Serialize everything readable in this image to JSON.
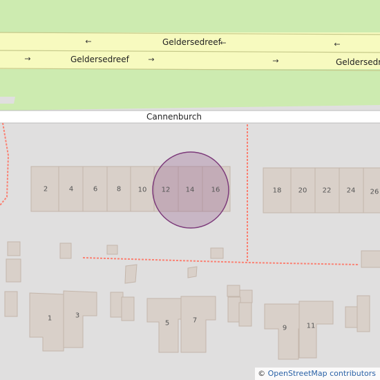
{
  "roads": {
    "main_road": "Geldersedreef",
    "side_road": "Cannenburch"
  },
  "house_numbers_top": [
    "2",
    "4",
    "6",
    "8",
    "10",
    "12",
    "14",
    "16",
    "18",
    "20",
    "22",
    "24",
    "26"
  ],
  "house_numbers_bottom": [
    "1",
    "3",
    "5",
    "7",
    "9",
    "11"
  ],
  "attribution": {
    "symbol": "©",
    "text": "OpenStreetMap contributors"
  },
  "colors": {
    "background": "#e0dfdf",
    "grass": "#cdebb0",
    "road_fill": "#f7fabf",
    "road_casing": "#c6c98a",
    "building": "#d9d0c9",
    "building_outline": "#c4b6ab",
    "path_dash": "#fa8072",
    "highlight_fill": "#9c6a95",
    "highlight_stroke": "#7c3a7a",
    "attribution_link": "#2a62a7"
  },
  "highlight": {
    "shape": "circle",
    "house": "14"
  }
}
